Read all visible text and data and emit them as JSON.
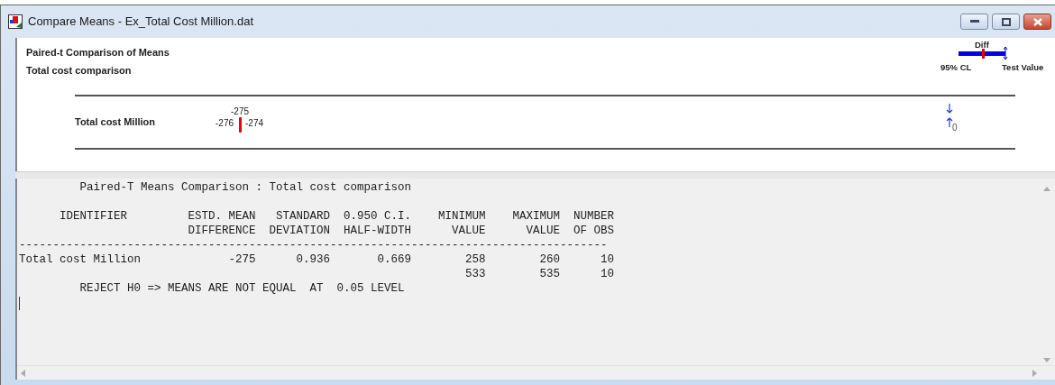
{
  "window": {
    "title": "Compare Means - Ex_Total Cost Million.dat"
  },
  "chart_panel": {
    "title": "Paired-t Comparison of Means",
    "subtitle": "Total cost comparison",
    "legend": {
      "label_top": "Diff",
      "label_left": "95% CL",
      "label_right": "Test Value"
    },
    "rows": [
      {
        "label": "Total cost Million",
        "mean": "-275",
        "lower": "-276",
        "upper": "-274"
      }
    ],
    "test_value": "0"
  },
  "report": {
    "title": "         Paired-T Means Comparison : Total cost comparison",
    "lines": [
      "      IDENTIFIER         ESTD. MEAN   STANDARD  0.950 C.I.    MINIMUM    MAXIMUM  NUMBER",
      "                         DIFFERENCE  DEVIATION  HALF-WIDTH      VALUE      VALUE  OF OBS",
      "---------------------------------------------------------------------------------------",
      "Total cost Million             -275      0.936       0.669        258        260      10",
      "                                                                  533        535      10",
      "         REJECT H0 => MEANS ARE NOT EQUAL  AT  0.05 LEVEL"
    ]
  }
}
